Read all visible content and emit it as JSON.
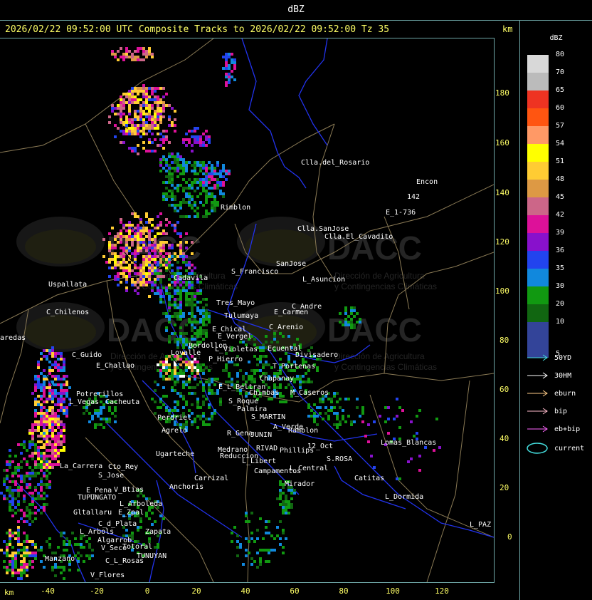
{
  "top_title": "dBZ",
  "header": {
    "text": "2026/02/22 09:52:00 UTC Composite Tracks to 2026/02/22 09:52:00 Tz 35",
    "unit": "km"
  },
  "axes": {
    "x_unit": "km",
    "y_ticks": [
      "180",
      "160",
      "140",
      "120",
      "100",
      "80",
      "60",
      "40",
      "20",
      "0"
    ],
    "x_ticks": [
      "-40",
      "-20",
      "0",
      "20",
      "40",
      "60",
      "80",
      "100",
      "120"
    ]
  },
  "legend": {
    "title": "dBZ",
    "levels": [
      {
        "label": "80",
        "color": "#d8d8d8"
      },
      {
        "label": "70",
        "color": "#bbbbbb"
      },
      {
        "label": "65",
        "color": "#ee3322"
      },
      {
        "label": "60",
        "color": "#ff5511"
      },
      {
        "label": "57",
        "color": "#ff9966"
      },
      {
        "label": "54",
        "color": "#ffff00"
      },
      {
        "label": "51",
        "color": "#ffcc33"
      },
      {
        "label": "48",
        "color": "#dd9944"
      },
      {
        "label": "45",
        "color": "#cc6688"
      },
      {
        "label": "42",
        "color": "#dd1199"
      },
      {
        "label": "39",
        "color": "#8811cc"
      },
      {
        "label": "36",
        "color": "#2244ee"
      },
      {
        "label": "35",
        "color": "#1188dd"
      },
      {
        "label": "30",
        "color": "#119911"
      },
      {
        "label": "20",
        "color": "#116611"
      },
      {
        "label": "10",
        "color": "#334499"
      },
      {
        "label": "5",
        "color": "#334499"
      }
    ],
    "tracks": [
      {
        "label": "50YD",
        "color": "#44dddd"
      },
      {
        "label": "30HM",
        "color": "#ffffff"
      },
      {
        "label": "eburn",
        "color": "#ffcc88"
      },
      {
        "label": "bip",
        "color": "#ffbbcc"
      },
      {
        "label": "eb+bip",
        "color": "#ff66ff"
      }
    ],
    "current_label": "current",
    "current_color": "#44dddd"
  },
  "watermark": {
    "brand": "DACC",
    "line1": "Dirección de Agricultura",
    "line2": "y Contingencias Climáticas"
  },
  "places": [
    {
      "name": "Clla.del_Rosario"
    },
    {
      "name": "Encon"
    },
    {
      "name": "142"
    },
    {
      "name": "E_1-736"
    },
    {
      "name": "Rimblon"
    },
    {
      "name": "Clla.SanJose"
    },
    {
      "name": "Clla.El_Cavadito"
    },
    {
      "name": "SanJose"
    },
    {
      "name": "S_Francisco"
    },
    {
      "name": "L_Asuncion"
    },
    {
      "name": "Uspallata"
    },
    {
      "name": "Tres_Mayo"
    },
    {
      "name": "C_Chilenos"
    },
    {
      "name": "E_Carmen"
    },
    {
      "name": "C_Andre"
    },
    {
      "name": "Tulumaya"
    },
    {
      "name": "E_Chical"
    },
    {
      "name": "E_Vergel"
    },
    {
      "name": "C_Arenio"
    },
    {
      "name": "Bordollon"
    },
    {
      "name": "L_Violetas"
    },
    {
      "name": "Ecuental"
    },
    {
      "name": "Divisadero"
    },
    {
      "name": "P_Hierro"
    },
    {
      "name": "T_Portenas"
    },
    {
      "name": "C_Guido"
    },
    {
      "name": "E_Challao"
    },
    {
      "name": "E_L_Beltran"
    },
    {
      "name": "Chapanay"
    },
    {
      "name": "Chimbas"
    },
    {
      "name": "M_Caseros"
    },
    {
      "name": "Potrerillos"
    },
    {
      "name": "Cacheuta"
    },
    {
      "name": "L_Vegas"
    },
    {
      "name": "S_Roque"
    },
    {
      "name": "Palmira"
    },
    {
      "name": "S_MARTIN"
    },
    {
      "name": "A_Verde"
    },
    {
      "name": "Ramblon"
    },
    {
      "name": "Perdriel"
    },
    {
      "name": "Agrelo"
    },
    {
      "name": "R_Gena"
    },
    {
      "name": "JUNIN"
    },
    {
      "name": "RIVAD"
    },
    {
      "name": "Phillips"
    },
    {
      "name": "12_Oct"
    },
    {
      "name": "Lomas_Blancas"
    },
    {
      "name": "Ugarteche"
    },
    {
      "name": "Medrano"
    },
    {
      "name": "Reduccion"
    },
    {
      "name": "L_Libert"
    },
    {
      "name": "Campamentos"
    },
    {
      "name": "L_Central"
    },
    {
      "name": "S.ROSA"
    },
    {
      "name": "La_Carrera"
    },
    {
      "name": "Cto_Rey"
    },
    {
      "name": "S_Jose"
    },
    {
      "name": "Carrizal"
    },
    {
      "name": "Catitas"
    },
    {
      "name": "E_Pena"
    },
    {
      "name": "V_Btias"
    },
    {
      "name": "Anchoris"
    },
    {
      "name": "TUPUNGATO"
    },
    {
      "name": "L_Arboleda"
    },
    {
      "name": "Mirador"
    },
    {
      "name": "L_Dormida"
    },
    {
      "name": "Gltallaru"
    },
    {
      "name": "E_Zpal"
    },
    {
      "name": "C_d_Plata"
    },
    {
      "name": "Zapata"
    },
    {
      "name": "L_Arbols"
    },
    {
      "name": "Algarrob"
    },
    {
      "name": "L_PAZ"
    },
    {
      "name": "V_Seco"
    },
    {
      "name": "Totoral"
    },
    {
      "name": "TUNUYAN"
    },
    {
      "name": "Manzano"
    },
    {
      "name": "C_L_Rosas"
    },
    {
      "name": "V_Flores"
    },
    {
      "name": "aredas"
    },
    {
      "name": "Cadavila"
    },
    {
      "name": "Lovalle"
    }
  ]
}
